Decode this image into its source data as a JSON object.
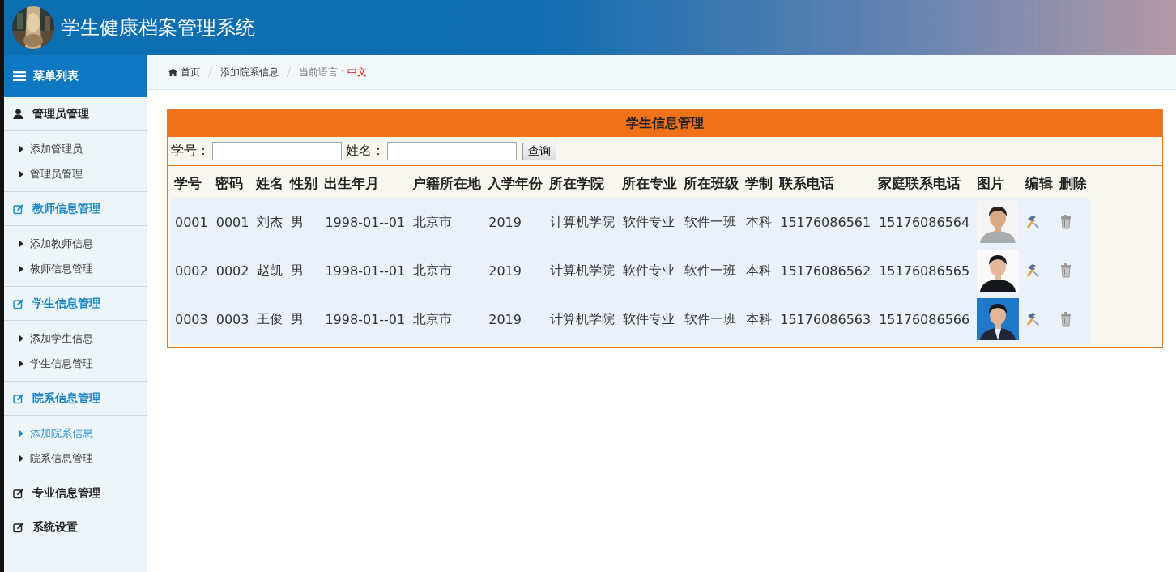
{
  "header": {
    "title": "学生健康档案管理系统"
  },
  "sidebar": {
    "title": "菜单列表",
    "groups": [
      {
        "label": "管理员管理",
        "highlighted": false,
        "items": [
          {
            "label": "添加管理员",
            "selected": false
          },
          {
            "label": "管理员管理",
            "selected": false
          }
        ]
      },
      {
        "label": "教师信息管理",
        "highlighted": true,
        "items": [
          {
            "label": "添加教师信息",
            "selected": false
          },
          {
            "label": "教师信息管理",
            "selected": false
          }
        ]
      },
      {
        "label": "学生信息管理",
        "highlighted": true,
        "items": [
          {
            "label": "添加学生信息",
            "selected": false
          },
          {
            "label": "学生信息管理",
            "selected": false
          }
        ]
      },
      {
        "label": "院系信息管理",
        "highlighted": true,
        "items": [
          {
            "label": "添加院系信息",
            "selected": true
          },
          {
            "label": "院系信息管理",
            "selected": false
          }
        ]
      },
      {
        "label": "专业信息管理",
        "highlighted": false
      },
      {
        "label": "系统设置",
        "highlighted": false
      }
    ]
  },
  "breadcrumb": {
    "items": [
      "首页",
      "添加院系信息"
    ],
    "language_label": "当前语言：",
    "language": "中文"
  },
  "panel": {
    "title": "学生信息管理",
    "search": {
      "fields": [
        {
          "label": "学号："
        },
        {
          "label": "姓名："
        }
      ],
      "button": "查询"
    },
    "columns": [
      "学号",
      "密码",
      "姓名",
      "性别",
      "出生年月",
      "户籍所在地",
      "入学年份",
      "所在学院",
      "所在专业",
      "所在班级",
      "学制",
      "联系电话",
      "家庭联系电话",
      "图片",
      "编辑",
      "删除"
    ],
    "rows": [
      {
        "cells": [
          "0001",
          "0001",
          "刘杰",
          "男",
          "1998-01--01",
          "北京市",
          "2019",
          "计算机学院",
          "软件专业",
          "软件一班",
          "本科",
          "15176086561",
          "15176086564"
        ]
      },
      {
        "cells": [
          "0002",
          "0002",
          "赵凯",
          "男",
          "1998-01--01",
          "北京市",
          "2019",
          "计算机学院",
          "软件专业",
          "软件一班",
          "本科",
          "15176086562",
          "15176086565"
        ]
      },
      {
        "cells": [
          "0003",
          "0003",
          "王俊",
          "男",
          "1998-01--01",
          "北京市",
          "2019",
          "计算机学院",
          "软件专业",
          "软件一班",
          "本科",
          "15176086563",
          "15176086566"
        ]
      }
    ]
  }
}
